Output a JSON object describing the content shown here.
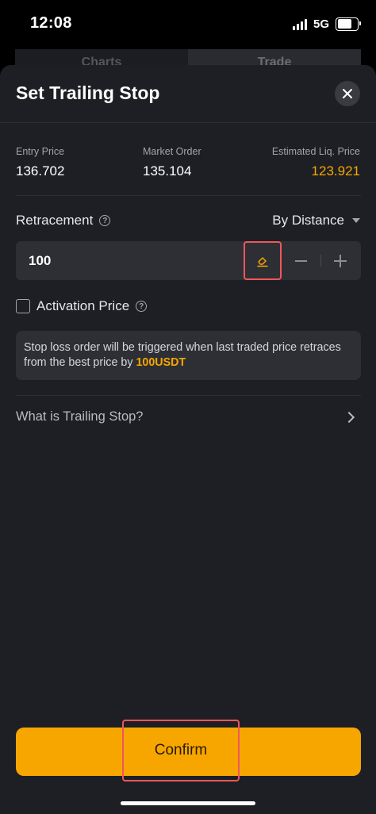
{
  "status_bar": {
    "time": "12:08",
    "network": "5G"
  },
  "background_tabs": [
    {
      "label": "Charts"
    },
    {
      "label": "Trade"
    }
  ],
  "sheet": {
    "title": "Set Trailing Stop",
    "info": {
      "entry_price_label": "Entry Price",
      "entry_price_value": "136.702",
      "market_order_label": "Market Order",
      "market_order_value": "135.104",
      "liq_price_label": "Estimated Liq. Price",
      "liq_price_value": "123.921"
    },
    "retracement": {
      "label": "Retracement",
      "mode": "By Distance",
      "value": "100"
    },
    "activation_price": {
      "label": "Activation Price",
      "checked": false
    },
    "note": {
      "text": "Stop loss order will be triggered when last traded price retraces from the best price by ",
      "highlight": "100USDT"
    },
    "help_link": "What is Trailing Stop?",
    "confirm_label": "Confirm"
  },
  "colors": {
    "accent": "#f7a600",
    "sheet_background": "#1e1f24",
    "input_background": "#2e2f35",
    "highlight_border": "#f0575a"
  },
  "icons": {
    "close": "close-icon",
    "clear": "eraser-icon",
    "help": "question-circle-icon",
    "chevron": "chevron-right-icon"
  }
}
